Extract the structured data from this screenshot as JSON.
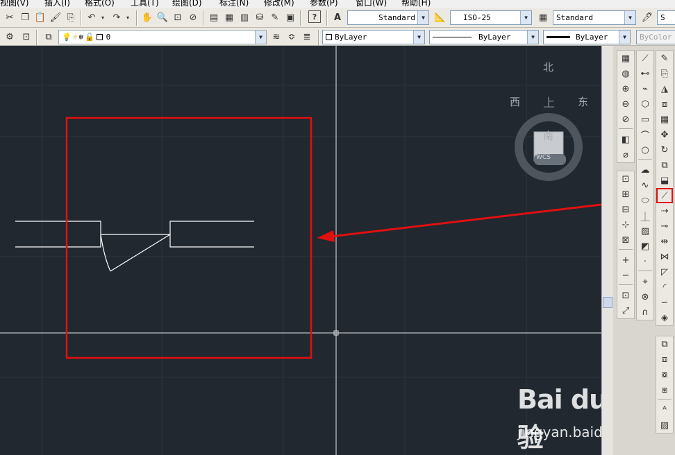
{
  "menu": [
    "视图(V)",
    "插入(I)",
    "格式(O)",
    "工具(T)",
    "绘图(D)",
    "标注(N)",
    "修改(M)",
    "参数(P)",
    "窗口(W)",
    "帮助(H)"
  ],
  "toolbar1": {
    "text_style": "Standard",
    "dim_style": "ISO-25",
    "table_style": "Standard",
    "cut_label": "S"
  },
  "toolbar2": {
    "layer": "0",
    "color": "ByLayer",
    "linetype": "ByLayer",
    "lineweight": "ByLayer",
    "plotstyle": "ByColor"
  },
  "viewcube": {
    "north": "北",
    "south": "南",
    "east": "东",
    "west": "西",
    "top": "上",
    "wcs": "WCS"
  },
  "watermark": {
    "logo": "Bai du 经验",
    "url": "jingyan.baidu.com"
  },
  "colors": {
    "canvas": "#212830",
    "highlight": "#e01010",
    "geometry": "#ffffff"
  }
}
